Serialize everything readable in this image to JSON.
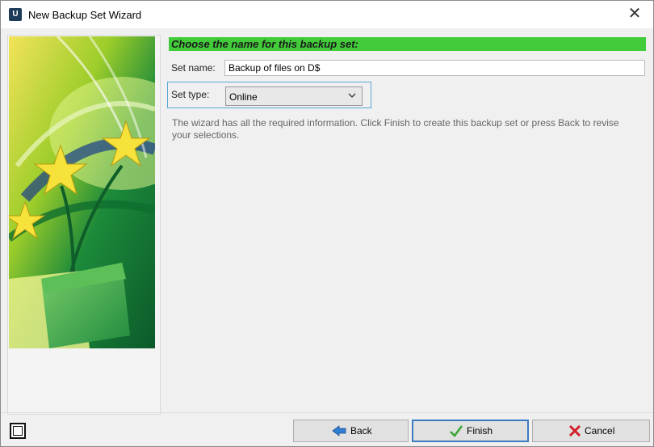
{
  "window": {
    "app_icon_letter": "U",
    "title": "New Backup Set Wizard",
    "close_glyph": "✕"
  },
  "heading": "Choose the name for this backup set:",
  "form": {
    "set_name_label": "Set name:",
    "set_name_value": "Backup of files on D$",
    "set_type_label": "Set type:",
    "set_type_value": "Online"
  },
  "info_text": "The wizard has all the required information. Click Finish to create this backup set or press Back to revise your selections.",
  "buttons": {
    "back": "Back",
    "finish": "Finish",
    "cancel": "Cancel"
  },
  "colors": {
    "heading_bar": "#43cc3a",
    "focus_border": "#5aa7d6",
    "default_button_border": "#3b7bc0"
  },
  "icons": {
    "window": "app-u-icon",
    "close": "close-icon",
    "dropdown": "chevron-down-icon",
    "back": "back-arrow-icon",
    "finish": "check-icon",
    "cancel": "x-icon",
    "footer": "window-icon"
  }
}
